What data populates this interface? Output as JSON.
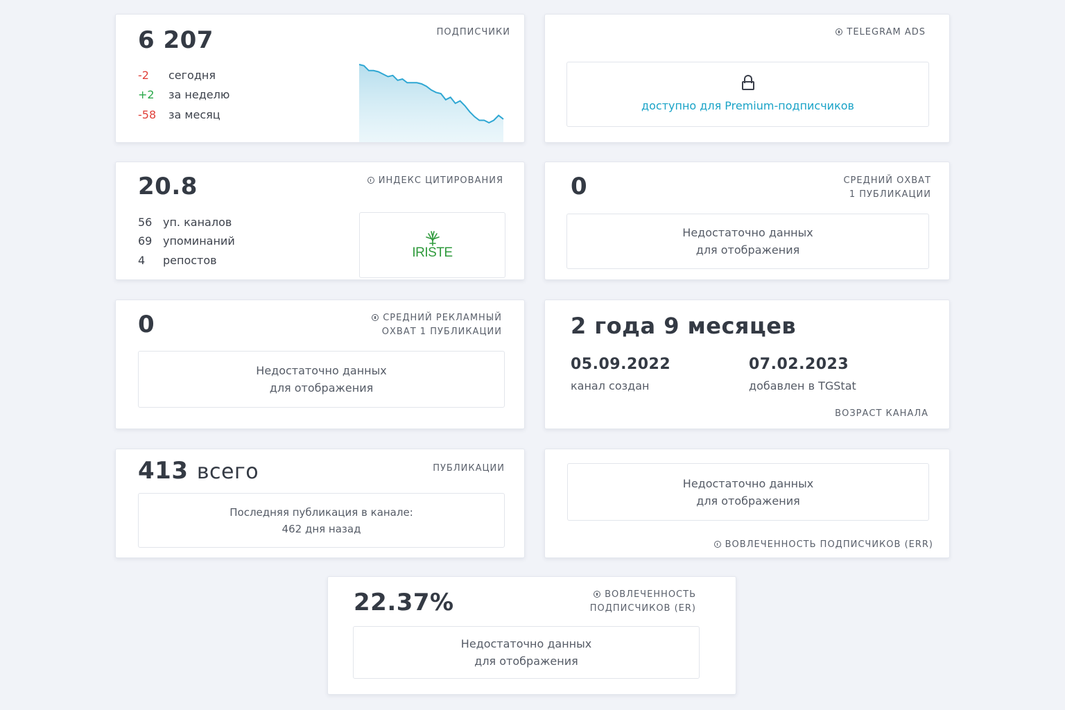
{
  "subscribers": {
    "value": "6 207",
    "label": "ПОДПИСЧИКИ",
    "stats": [
      {
        "num": "-2",
        "text": "сегодня",
        "tone": "red"
      },
      {
        "num": "+2",
        "text": "за неделю",
        "tone": "green"
      },
      {
        "num": "-58",
        "text": "за месяц",
        "tone": "red"
      }
    ],
    "sparkline": [
      100,
      99,
      95,
      95,
      94,
      92,
      90,
      91,
      87,
      88,
      85,
      85,
      85,
      84,
      82,
      79,
      77,
      76,
      71,
      73,
      68,
      70,
      66,
      61,
      57,
      54,
      54,
      52,
      54,
      58,
      55
    ]
  },
  "telegram_ads": {
    "label": "TELEGRAM ADS",
    "locked_text": "доступно для Premium-подписчиков"
  },
  "citation": {
    "value": "20.8",
    "label": "ИНДЕКС ЦИТИРОВАНИЯ",
    "stats": [
      {
        "num": "56",
        "text": "уп. каналов"
      },
      {
        "num": "69",
        "text": "упоминаний"
      },
      {
        "num": "4",
        "text": "репостов"
      }
    ],
    "logo_text": "IRISTE"
  },
  "avg_reach": {
    "value": "0",
    "label_line1": "СРЕДНИЙ ОХВАТ",
    "label_line2": "1 ПУБЛИКАЦИИ",
    "empty_line1": "Недостаточно данных",
    "empty_line2": "для отображения"
  },
  "ad_reach": {
    "value": "0",
    "label_line1": "СРЕДНИЙ РЕКЛАМНЫЙ",
    "label_line2": "ОХВАТ 1 ПУБЛИКАЦИИ",
    "empty_line1": "Недостаточно данных",
    "empty_line2": "для отображения"
  },
  "channel_age": {
    "value": "2 года 9 месяцев",
    "created_date": "05.09.2022",
    "created_label": "канал создан",
    "added_date": "07.02.2023",
    "added_label": "добавлен в TGStat",
    "label": "ВОЗРАСТ КАНАЛА"
  },
  "publications": {
    "value": "413",
    "unit": "всего",
    "label": "ПУБЛИКАЦИИ",
    "last_line1": "Последняя публикация в канале:",
    "last_line2": "462 дня назад"
  },
  "err": {
    "label": "ВОВЛЕЧЕННОСТЬ ПОДПИСЧИКОВ (ERR)",
    "empty_line1": "Недостаточно данных",
    "empty_line2": "для отображения"
  },
  "er": {
    "value": "22.37%",
    "label_line1": "ВОВЛЕЧЕННОСТЬ",
    "label_line2": "ПОДПИСЧИКОВ (ER)",
    "empty_line1": "Недостаточно данных",
    "empty_line2": "для отображения"
  },
  "colors": {
    "negative": "#e0413b",
    "positive": "#2aa84a",
    "accent": "#1aa3c7",
    "sparkline": "#2fa7d3",
    "logo": "#2f9a3c"
  }
}
